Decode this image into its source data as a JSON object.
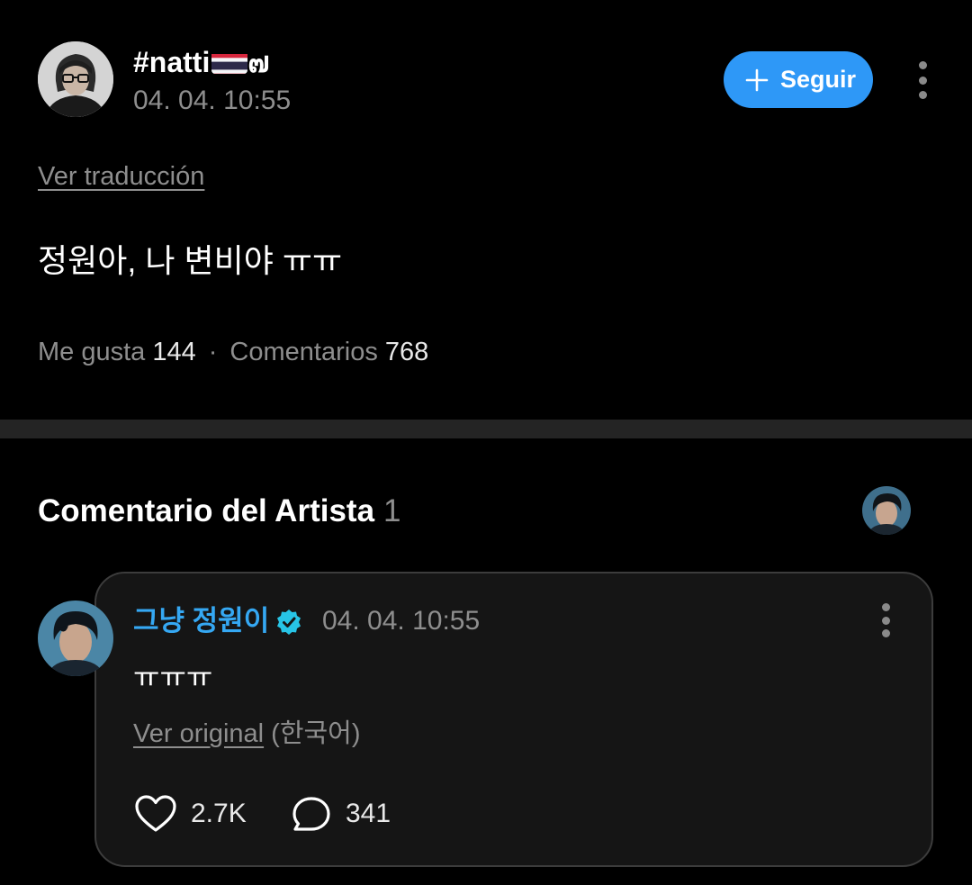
{
  "post": {
    "author_name": "#natti",
    "author_suffix": "๗",
    "timestamp": "04. 04. 10:55",
    "follow_label": "Seguir",
    "translate_label": "Ver traducción",
    "body": "정원아, 나 변비야 ㅠㅠ",
    "likes_label": "Me gusta",
    "likes_count": "144",
    "separator": "·",
    "comments_label": "Comentarios",
    "comments_count": "768",
    "flag": "thailand-flag"
  },
  "artist_section": {
    "title": "Comentario del Artista",
    "count": "1"
  },
  "comment": {
    "author_name": "그냥 정원이",
    "timestamp": "04. 04. 10:55",
    "text": "ㅠㅠㅠ",
    "original_link": "Ver original",
    "original_language": "(한국어)",
    "likes": "2.7K",
    "replies": "341",
    "name_color": "#35a8f3",
    "verified_icon": "verified-badge-icon"
  },
  "colors": {
    "accent": "#2e98f7",
    "background": "#000000",
    "card": "#151515",
    "muted": "#8e8e8e"
  }
}
